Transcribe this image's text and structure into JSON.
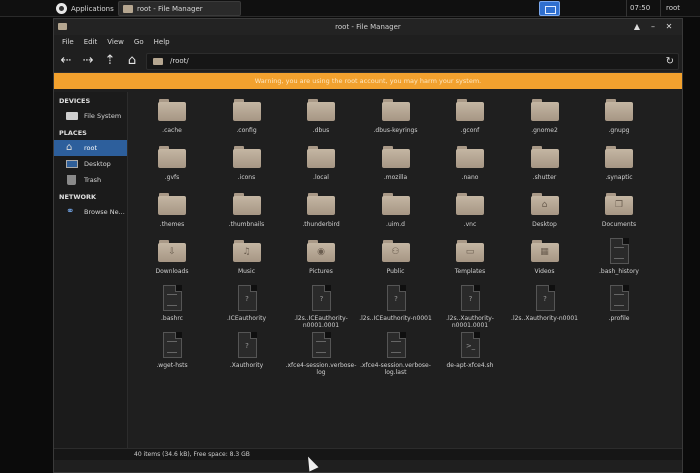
{
  "taskbar": {
    "apps_label": "Applications",
    "task_label": "root - File Manager",
    "clock": "07:50",
    "user": "root"
  },
  "window": {
    "title": "root - File Manager"
  },
  "menu": [
    "File",
    "Edit",
    "View",
    "Go",
    "Help"
  ],
  "toolbar": {
    "back_icon": "back-arrow-icon",
    "forward_icon": "forward-arrow-icon",
    "up_icon": "up-arrow-icon",
    "home_icon": "home-icon",
    "path": "/root/",
    "reload_icon": "reload-icon"
  },
  "warning": "Warning, you are using the root account, you may harm your system.",
  "sidebar": {
    "devices_header": "DEVICES",
    "devices": [
      {
        "label": "File System",
        "icon": "drive-icon"
      }
    ],
    "places_header": "PLACES",
    "places": [
      {
        "label": "root",
        "icon": "home-icon",
        "selected": true
      },
      {
        "label": "Desktop",
        "icon": "desktop-icon"
      },
      {
        "label": "Trash",
        "icon": "trash-icon"
      }
    ],
    "network_header": "NETWORK",
    "network": [
      {
        "label": "Browse Ne...",
        "icon": "network-icon"
      }
    ]
  },
  "files": [
    {
      "name": ".cache",
      "type": "folder"
    },
    {
      "name": ".config",
      "type": "folder"
    },
    {
      "name": ".dbus",
      "type": "folder"
    },
    {
      "name": ".dbus-keyrings",
      "type": "folder"
    },
    {
      "name": ".gconf",
      "type": "folder"
    },
    {
      "name": ".gnome2",
      "type": "folder"
    },
    {
      "name": ".gnupg",
      "type": "folder"
    },
    {
      "name": ".gvfs",
      "type": "folder"
    },
    {
      "name": ".icons",
      "type": "folder"
    },
    {
      "name": ".local",
      "type": "folder"
    },
    {
      "name": ".mozilla",
      "type": "folder"
    },
    {
      "name": ".nano",
      "type": "folder"
    },
    {
      "name": ".shutter",
      "type": "folder"
    },
    {
      "name": ".synaptic",
      "type": "folder"
    },
    {
      "name": ".themes",
      "type": "folder"
    },
    {
      "name": ".thumbnails",
      "type": "folder"
    },
    {
      "name": ".thunderbird",
      "type": "folder"
    },
    {
      "name": ".uim.d",
      "type": "folder"
    },
    {
      "name": ".vnc",
      "type": "folder"
    },
    {
      "name": "Desktop",
      "type": "folder",
      "emblem": "⌂"
    },
    {
      "name": "Documents",
      "type": "folder",
      "emblem": "❐"
    },
    {
      "name": "Downloads",
      "type": "folder",
      "emblem": "⇩"
    },
    {
      "name": "Music",
      "type": "folder",
      "emblem": "♫"
    },
    {
      "name": "Pictures",
      "type": "folder",
      "emblem": "◉"
    },
    {
      "name": "Public",
      "type": "folder",
      "emblem": "⚇"
    },
    {
      "name": "Templates",
      "type": "folder",
      "emblem": "▭"
    },
    {
      "name": "Videos",
      "type": "folder",
      "emblem": "▦"
    },
    {
      "name": ".bash_history",
      "type": "doc",
      "mark": "lines"
    },
    {
      "name": ".bashrc",
      "type": "doc",
      "mark": "lines"
    },
    {
      "name": ".ICEauthority",
      "type": "doc",
      "mark": "?"
    },
    {
      "name": ".l2s..ICEauthority-n0001.0001",
      "type": "doc",
      "mark": "?"
    },
    {
      "name": ".l2s..ICEauthority-n0001",
      "type": "doc",
      "mark": "?"
    },
    {
      "name": ".l2s..Xauthority-n0001.0001",
      "type": "doc",
      "mark": "?"
    },
    {
      "name": ".l2s..Xauthority-n0001",
      "type": "doc",
      "mark": "?"
    },
    {
      "name": ".profile",
      "type": "doc",
      "mark": "lines"
    },
    {
      "name": ".wget-hsts",
      "type": "doc",
      "mark": "lines"
    },
    {
      "name": ".Xauthority",
      "type": "doc",
      "mark": "?"
    },
    {
      "name": ".xfce4-session.verbose-log",
      "type": "doc",
      "mark": "lines"
    },
    {
      "name": ".xfce4-session.verbose-log.last",
      "type": "doc",
      "mark": "lines"
    },
    {
      "name": "de-apt-xfce4.sh",
      "type": "doc",
      "mark": ">_"
    }
  ],
  "status": "40 items (34.6 kB), Free space: 8.3 GB"
}
